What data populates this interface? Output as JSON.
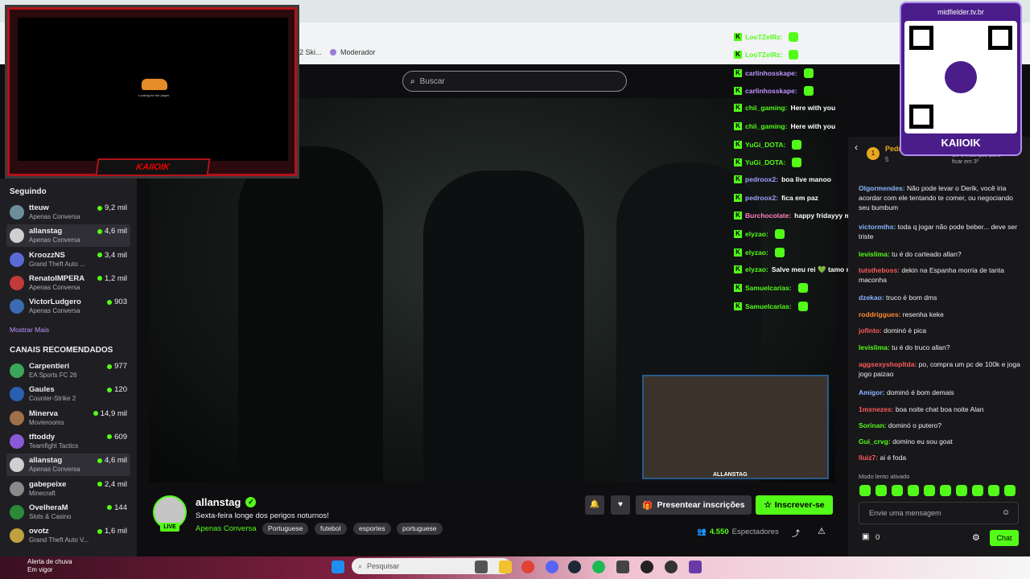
{
  "browser": {
    "bookmarks": [
      {
        "label": "2 Ski..."
      },
      {
        "label": "Moderador"
      }
    ]
  },
  "search": {
    "placeholder": "Buscar"
  },
  "overlay": {
    "logo_text": "KAIIOIK",
    "loading_text": "Looking for the player"
  },
  "sidebar": {
    "following_title": "Seguindo",
    "following": [
      {
        "name": "tteuw",
        "sub": "Apenas Conversa",
        "count": "9,2 mil",
        "color": "#6b8e9a"
      },
      {
        "name": "allanstag",
        "sub": "Apenas Conversa",
        "count": "4,6 mil",
        "color": "#d0d0d0",
        "active": true
      },
      {
        "name": "KroozzNS",
        "sub": "Grand Theft Auto ...",
        "count": "3,4 mil",
        "color": "#5b6bd6"
      },
      {
        "name": "RenatoIMPERA",
        "sub": "Apenas Conversa",
        "count": "1,2 mil",
        "color": "#c23a3a"
      },
      {
        "name": "VictorLudgero",
        "sub": "Apenas Conversa",
        "count": "903",
        "color": "#3a6bb3"
      }
    ],
    "show_more": "Mostrar Mais",
    "recommended_title": "CANAIS RECOMENDADOS",
    "recommended": [
      {
        "name": "Carpentieri",
        "sub": "EA Sports FC 26",
        "count": "977",
        "color": "#3aa65a"
      },
      {
        "name": "Gaules",
        "sub": "Counter-Strike 2",
        "count": "120",
        "color": "#2b5fb0"
      },
      {
        "name": "Minerva",
        "sub": "Movierooms",
        "count": "14,9 mil",
        "color": "#a0704a"
      },
      {
        "name": "tftoddy",
        "sub": "Teamfight Tactics",
        "count": "609",
        "color": "#8a5ad6"
      },
      {
        "name": "allanstag",
        "sub": "Apenas Conversa",
        "count": "4,6 mil",
        "color": "#d0d0d0",
        "active": true
      },
      {
        "name": "gabepeixe",
        "sub": "Minecraft",
        "count": "2,4 mil",
        "color": "#8a8a8a"
      },
      {
        "name": "OvelheraM",
        "sub": "Slots & Casino",
        "count": "144",
        "color": "#2a8a3a"
      },
      {
        "name": "ovotz",
        "sub": "Grand Theft Auto V...",
        "count": "1,6 mil",
        "color": "#c0a040"
      }
    ]
  },
  "overlay_chat": [
    {
      "name": "LooTZelRz:",
      "msg": "",
      "color": "#53fc18"
    },
    {
      "name": "LooTZelRz:",
      "msg": "",
      "color": "#53fc18"
    },
    {
      "name": "carlinhosskape:",
      "msg": "",
      "color": "#bf94ff"
    },
    {
      "name": "carlinhosskape:",
      "msg": "",
      "color": "#bf94ff"
    },
    {
      "name": "chii_gaming:",
      "msg": "Here with you",
      "color": "#53fc18"
    },
    {
      "name": "chii_gaming:",
      "msg": "Here with you",
      "color": "#53fc18"
    },
    {
      "name": "YuGi_DOTA:",
      "msg": "",
      "color": "#53fc18"
    },
    {
      "name": "YuGi_DOTA:",
      "msg": "",
      "color": "#53fc18"
    },
    {
      "name": "pedroox2:",
      "msg": "boa live manoo",
      "color": "#a0a0ff"
    },
    {
      "name": "pedroox2:",
      "msg": "fica em paz",
      "color": "#a0a0ff"
    },
    {
      "name": "Burchocolate:",
      "msg": "happy fridayyy much love & have a great stream! chocolate alway",
      "color": "#ff80c0"
    },
    {
      "name": "elyzao:",
      "msg": "",
      "color": "#53fc18"
    },
    {
      "name": "elyzao:",
      "msg": "",
      "color": "#53fc18"
    },
    {
      "name": "elyzao:",
      "msg": "Salve meu rei 💚 tamo no apoio 💚",
      "color": "#53fc18"
    },
    {
      "name": "Samuelcarias:",
      "msg": "",
      "color": "#53fc18"
    },
    {
      "name": "Samuelcarias:",
      "msg": "",
      "color": "#53fc18"
    }
  ],
  "qr": {
    "url": "midfielder.tv.br",
    "name": "KAIIOIK"
  },
  "chat_header": {
    "name": "Pedr",
    "note": "De 1 inscrição para ficar em 3º",
    "count": "5"
  },
  "chat": [
    {
      "user": "Olgormendes:",
      "text": "Não pode levar o Derik, você iria acordar com ele tentando te comer, ou negociando seu bumbum",
      "color": "#8ab4ff"
    },
    {
      "user": "victormths:",
      "text": "toda q jogar não pode beber... deve ser triste",
      "color": "#8ab4ff"
    },
    {
      "user": "levislima:",
      "text": "tu é do carteado allan?",
      "color": "#53fc18"
    },
    {
      "user": "tutstheboss:",
      "text": "dekin na Espanha morria de tanta maconha",
      "color": "#ff5a5a"
    },
    {
      "user": "dzekao:",
      "text": "truco é bom dms",
      "color": "#8ab4ff"
    },
    {
      "user": "roddriggues:",
      "text": "resenha keke",
      "color": "#ff8a30"
    },
    {
      "user": "jofinto:",
      "text": "dominó é pica",
      "color": "#ff5a5a"
    },
    {
      "user": "levislima:",
      "text": "tu é do truco allan?",
      "color": "#53fc18"
    },
    {
      "user": "aggsexyshopltda:",
      "text": "po, compra um pc de 100k e joga jogo paizao",
      "color": "#ff5a5a"
    },
    {
      "user": "Amigor:",
      "text": "dominó é bom demais",
      "color": "#8ab4ff"
    },
    {
      "user": "1mxnezes:",
      "text": "boa noite chat boa noite Alan",
      "color": "#ff5a5a"
    },
    {
      "user": "Sorinan:",
      "text": "dominó o putero?",
      "color": "#53fc18"
    },
    {
      "user": "Gui_crvg:",
      "text": "domino eu sou goat",
      "color": "#53fc18"
    },
    {
      "user": "lluiz7:",
      "text": "ai é foda",
      "color": "#ff5a5a"
    }
  ],
  "chat_footer": {
    "slow_mode": "Modo lento ativado",
    "input_placeholder": "Envie uma mensagem",
    "chat_button": "Chat",
    "points": "0"
  },
  "channel": {
    "name": "allanstag",
    "live": "LIVE",
    "title": "Sexta-feira longe dos perigos noturnos!",
    "category": "Apenas Conversa",
    "tags": [
      "Portuguese",
      "futebol",
      "esportes",
      "portuguese"
    ],
    "gift_label": "Presentear inscrições",
    "subscribe_label": "Inscrever-se",
    "viewers": "4.550",
    "viewers_label": "Espectadores"
  },
  "webcam": {
    "label": "ALLANSTAG"
  },
  "taskbar": {
    "weather_line1": "Alerta de chuva",
    "weather_line2": "Em vigor",
    "search_placeholder": "Pesquisar"
  },
  "colors": {
    "accent": "#53fc18",
    "overlay_red": "#b3121b",
    "qr_purple": "#4a1d8a"
  }
}
